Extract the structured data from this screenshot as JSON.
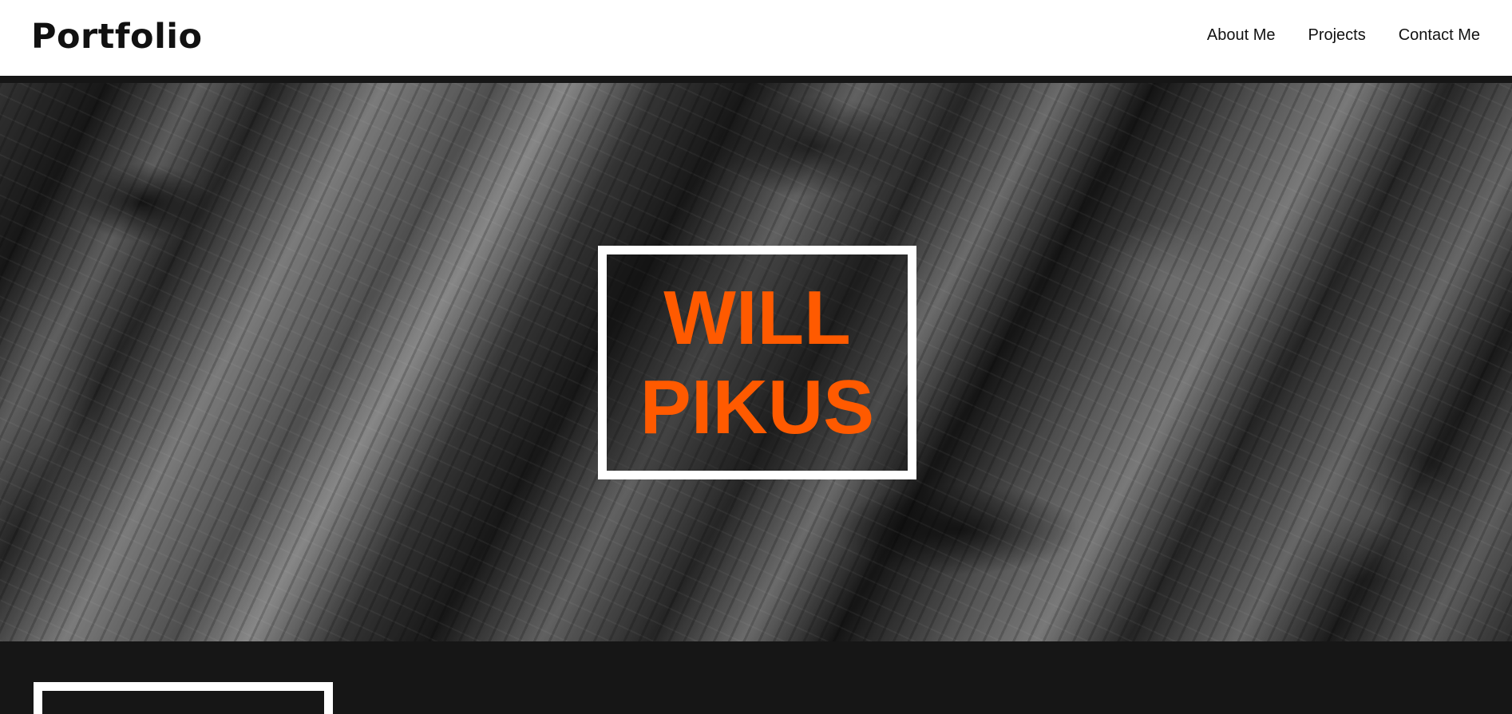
{
  "header": {
    "brand": "Portfolio",
    "nav": [
      {
        "label": "About Me"
      },
      {
        "label": "Projects"
      },
      {
        "label": "Contact Me"
      }
    ]
  },
  "hero": {
    "title_lines": [
      "WILL",
      "PIKUS"
    ]
  },
  "colors": {
    "accent": "#ff5a00",
    "header_bg": "#ffffff",
    "page_bg": "#161616",
    "frame": "#ffffff"
  }
}
